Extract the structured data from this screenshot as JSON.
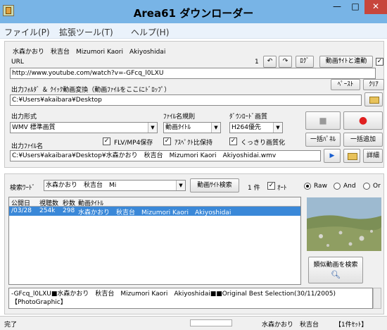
{
  "window": {
    "title": "Area61 ダウンローダー",
    "minimize": "—",
    "maximize": "□",
    "close": "✕"
  },
  "menu": [
    "ファイル(P)",
    "拡張ツール(T)",
    "ヘルプ(H)"
  ],
  "info": {
    "tags": "水森かおり　秋吉台　Mizumori Kaori　Akiyoshidai",
    "url_label": "URL",
    "counter": "1",
    "back_icon": "↶",
    "forward_icon": "↷",
    "log_button": "ﾛｸﾞ",
    "link_button": "動画ｻｲﾄと連動",
    "link_checked": "✓",
    "url_value": "http://www.youtube.com/watch?v=-GFcq_l0LXU",
    "paste_button": "ﾍﾟｰｽﾄ",
    "clear_button": "ｸﾘｱ",
    "output_folder_label": "出力ﾌｫﾙﾀﾞ ＆ ｸｲｯｸ動画変換（動画ﾌｧｲﾙをここにﾄﾞﾛｯﾌﾟ）",
    "output_folder_value": "C:¥Users¥akaibara¥Desktop",
    "format_label": "出力形式",
    "format_value": "WMV 標準画質",
    "filename_rule_label": "ﾌｧｲﾙ名規則",
    "filename_rule_value": "動画ﾀｲﾄﾙ",
    "quality_label": "ﾀﾞｳﾝﾛｰﾄﾞ画質",
    "quality_value": "H264優先",
    "flv_label": "FLV/MP4保存",
    "aspect_label": "ｱｽﾍﾟｸﾄ比保持",
    "sharp_label": "くっきり画質化",
    "flv_checked": "✓",
    "aspect_checked": "✓",
    "sharp_checked": "✓",
    "output_file_label": "出力ﾌｧｲﾙ名",
    "output_file_value": "C:¥Users¥akaibara¥Desktop¥水森かおり　秋吉台　Mizumori Kaori　Akiyoshidai.wmv",
    "batch_panel_button": "一括ﾊﾟﾈﾙ",
    "batch_add_button": "一括追加",
    "detail_button": "詳細",
    "stop_icon": "■",
    "record_icon": "●",
    "play_icon": "▶"
  },
  "search": {
    "keyword_label": "検索ﾜｰﾄﾞ",
    "keyword_value": "水森かおり　秋吉台　Mi",
    "search_button": "動画ｻｲﾄ検索",
    "count": "1 件",
    "auto_label": "ｵｰﾄ",
    "auto_checked": "✓",
    "radio_raw": "Raw",
    "radio_and": "And",
    "radio_or": "Or",
    "similar_button": "類似動画を検索"
  },
  "table": {
    "headers": [
      "公開日",
      "視聴数",
      "秒数",
      "動画ﾀｲﾄﾙ"
    ],
    "rows": [
      [
        "/03/28",
        "254k",
        "298",
        "水森かおり　秋吉台　Mizumori Kaori　Akiyoshidai"
      ]
    ]
  },
  "description": "-GFcq_l0LXU■水森かおり　秋吉台　Mizumori Kaori　Akiyoshidai■■Original Best Selection(30/11/2005)【PhotoGraphic】",
  "status": {
    "state": "完了",
    "title": "水森かおり　秋吉台",
    "count": "【1件ｾｯﾄ】"
  }
}
